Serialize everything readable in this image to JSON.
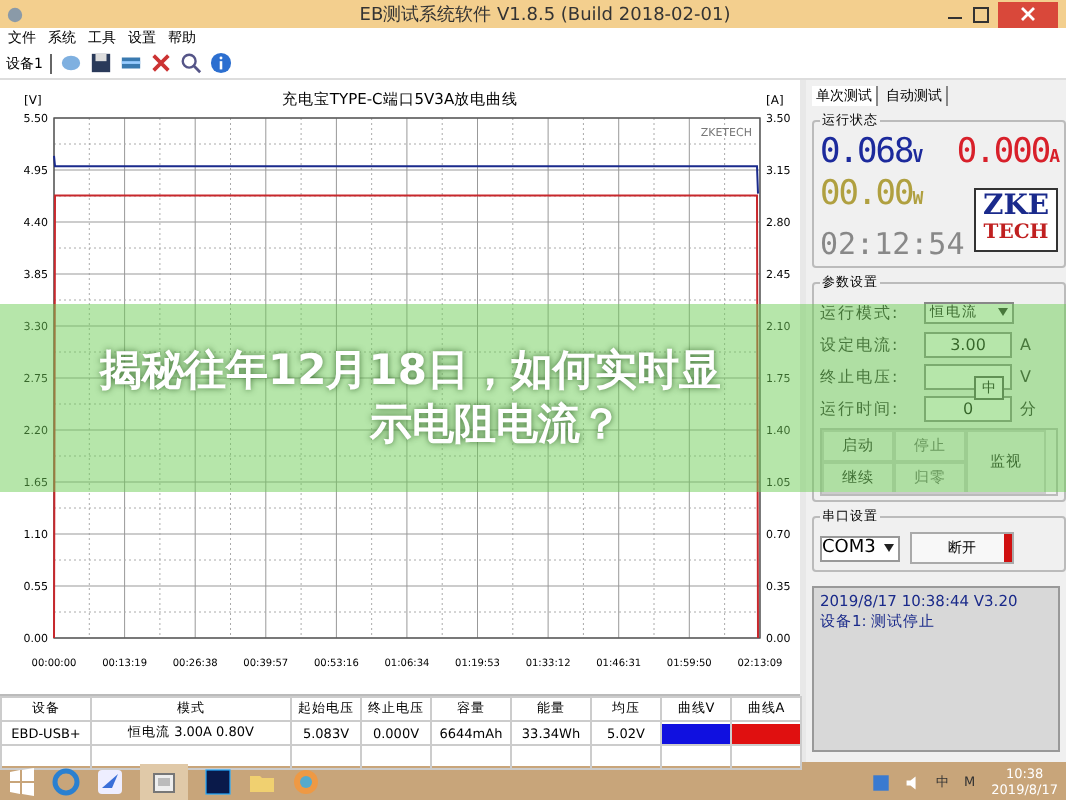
{
  "window": {
    "title": "EB测试系统软件 V1.8.5 (Build 2018-02-01)"
  },
  "menu": [
    "文件",
    "系统",
    "工具",
    "设置",
    "帮助"
  ],
  "toolbar": {
    "device": "设备1"
  },
  "chart": {
    "title": "充电宝TYPE-C端口5V3A放电曲线",
    "brand": "ZKETECH",
    "right_ticks": [
      "3.50",
      "3.15",
      "2.80",
      "2.45",
      "2.10",
      "1.75",
      "1.40",
      "1.05",
      "0.70",
      "0.35",
      "0.00"
    ],
    "chart_data": {
      "type": "line",
      "grid": true,
      "x": [
        0,
        12,
        7956,
        7968
      ],
      "xlim": [
        0,
        7990
      ],
      "ylim": [
        0,
        5.5
      ],
      "yticks": [
        {
          "value": 0,
          "label": "0.00"
        },
        {
          "value": 0.55,
          "label": "0.55"
        },
        {
          "value": 1.1,
          "label": "1.10"
        },
        {
          "value": 1.65,
          "label": "1.65"
        },
        {
          "value": 2.2,
          "label": "2.20"
        },
        {
          "value": 2.75,
          "label": "2.75"
        },
        {
          "value": 3.3,
          "label": "3.30"
        },
        {
          "value": 3.85,
          "label": "3.85"
        },
        {
          "value": 4.4,
          "label": "4.40"
        },
        {
          "value": 4.95,
          "label": "4.95"
        },
        {
          "value": 5.5,
          "label": "5.50"
        }
      ],
      "xticks": [
        {
          "value": 0,
          "label": "00:00:00"
        },
        {
          "value": 799,
          "label": "00:13:19"
        },
        {
          "value": 1598,
          "label": "00:26:38"
        },
        {
          "value": 2397,
          "label": "00:39:57"
        },
        {
          "value": 3196,
          "label": "00:53:16"
        },
        {
          "value": 3994,
          "label": "01:06:34"
        },
        {
          "value": 4793,
          "label": "01:19:53"
        },
        {
          "value": 5592,
          "label": "01:33:12"
        },
        {
          "value": 6391,
          "label": "01:46:31"
        },
        {
          "value": 7190,
          "label": "01:59:50"
        },
        {
          "value": 7989,
          "label": "02:13:09"
        }
      ],
      "series": [
        {
          "name": "[V]",
          "color": "#1a2a8c",
          "values": [
            5.1,
            4.99,
            4.99,
            4.7
          ]
        },
        {
          "name": "[A]",
          "color": "#c8282d",
          "values": [
            0,
            4.68,
            4.68,
            0
          ]
        }
      ]
    }
  },
  "table": {
    "columns": [
      "设备",
      "模式",
      "起始电压",
      "终止电压",
      "容量",
      "能量",
      "均压",
      "曲线V",
      "曲线A"
    ],
    "rows": [
      {
        "cells": [
          "EBD-USB+",
          "恒电流 3.00A 0.80V",
          "5.083V",
          "0.000V",
          "6644mAh",
          "33.34Wh",
          "5.02V"
        ],
        "curves": [
          {
            "color": "#1010e0"
          },
          {
            "color": "#e01010"
          }
        ]
      }
    ]
  },
  "panel": {
    "tabs": [
      {
        "label": "单次测试",
        "selected": true
      },
      {
        "label": "自动测试",
        "selected": false
      }
    ],
    "status_group": "运行状态",
    "readings": [
      {
        "kind": "voltage",
        "value": "0.068",
        "unit": "V",
        "color": "#1c2a9c"
      },
      {
        "kind": "current",
        "value": "0.000",
        "unit": "A",
        "color": "#d8202a"
      },
      {
        "kind": "power",
        "value": "00.00",
        "unit": "W",
        "color": "#b0a040"
      },
      {
        "kind": "time",
        "value": "02:12:54",
        "color": "#888888"
      }
    ],
    "logo": [
      "ZKE",
      "TECH"
    ],
    "params_group": "参数设置",
    "params": [
      {
        "kind": "select",
        "label": "运行模式:",
        "value": "恒电流"
      },
      {
        "kind": "input",
        "label": "设定电流:",
        "value": "3.00",
        "unit": "A"
      },
      {
        "kind": "input",
        "label": "终止电压:",
        "unit": "V"
      },
      {
        "kind": "input",
        "label": "运行时间:",
        "value": "0",
        "unit": "分"
      }
    ],
    "ime_indicator": "中",
    "buttons": [
      {
        "label": "启动",
        "disabled": false
      },
      {
        "label": "停止",
        "disabled": true
      },
      {
        "label": "继续",
        "disabled": false
      },
      {
        "label": "归零",
        "disabled": true
      },
      {
        "label": "监视",
        "disabled": false
      }
    ],
    "serial_group": "串口设置",
    "port": "COM3",
    "connect_button": "断开",
    "connected": true,
    "log": [
      "2019/8/17 10:38:44  V3.20",
      "设备1: 测试停止"
    ]
  },
  "taskbar": {
    "tray": [
      "中",
      "M"
    ],
    "time": "10:38",
    "date": "2019/8/17"
  },
  "banner": {
    "lines": [
      "揭秘往年12月18日，如何实时显",
      "示电阻电流？"
    ]
  }
}
